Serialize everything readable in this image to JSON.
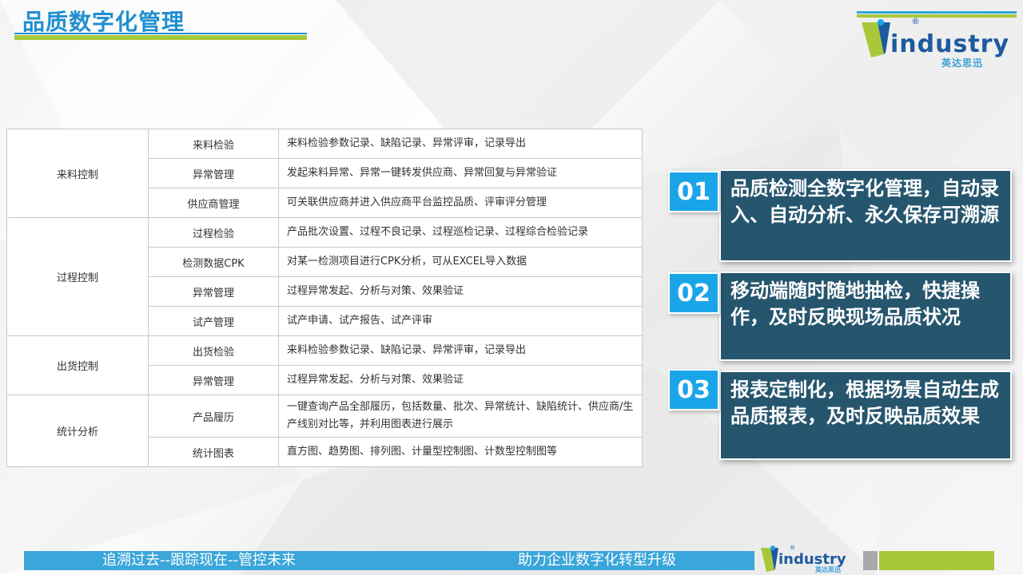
{
  "page_title": "品质数字化管理",
  "logo": {
    "word": "industry",
    "registered_mark": "®",
    "chinese": "英达思迅"
  },
  "table": {
    "groups": [
      {
        "category": "来料控制",
        "rows": [
          {
            "item": "来料检验",
            "desc": "来料检验参数记录、缺陷记录、异常评审，记录导出"
          },
          {
            "item": "异常管理",
            "desc": "发起来料异常、异常一键转发供应商、异常回复与异常验证"
          },
          {
            "item": "供应商管理",
            "desc": "可关联供应商并进入供应商平台监控品质、评审评分管理"
          }
        ]
      },
      {
        "category": "过程控制",
        "rows": [
          {
            "item": "过程检验",
            "desc": "产品批次设置、过程不良记录、过程巡检记录、过程综合检验记录"
          },
          {
            "item": "检测数据CPK",
            "desc": "对某一检测项目进行CPK分析，可从EXCEL导入数据"
          },
          {
            "item": "异常管理",
            "desc": "过程异常发起、分析与对策、效果验证"
          },
          {
            "item": "试产管理",
            "desc": "试产申请、试产报告、试产评审"
          }
        ]
      },
      {
        "category": "出货控制",
        "rows": [
          {
            "item": "出货检验",
            "desc": "来料检验参数记录、缺陷记录、异常评审，记录导出"
          },
          {
            "item": "异常管理",
            "desc": "过程异常发起、分析与对策、效果验证"
          }
        ]
      },
      {
        "category": "统计分析",
        "rows": [
          {
            "item": "产品履历",
            "desc": "一键查询产品全部履历，包括数量、批次、异常统计、缺陷统计、供应商/生产线别对比等，并利用图表进行展示"
          },
          {
            "item": "统计图表",
            "desc": "直方图、趋势图、排列图、计量型控制图、计数型控制图等"
          }
        ]
      }
    ]
  },
  "highlights": [
    {
      "number": "01",
      "text": "品质检测全数字化管理，自动录入、自动分析、永久保存可溯源"
    },
    {
      "number": "02",
      "text": "移动端随时随地抽检，快捷操作，及时反映现场品质状况"
    },
    {
      "number": "03",
      "text": "报表定制化，根据场景自动生成品质报表，及时反映品质效果"
    }
  ],
  "footer": {
    "left": "追溯过去--跟踪现在--管控未来",
    "right": "助力企业数字化转型升级"
  },
  "colors": {
    "title_blue": "#1f8fd0",
    "accent_green": "#a8c83a",
    "number_blue": "#1aa5e8",
    "card_teal": "#26566e",
    "footer_blue": "#3aa6d9"
  }
}
